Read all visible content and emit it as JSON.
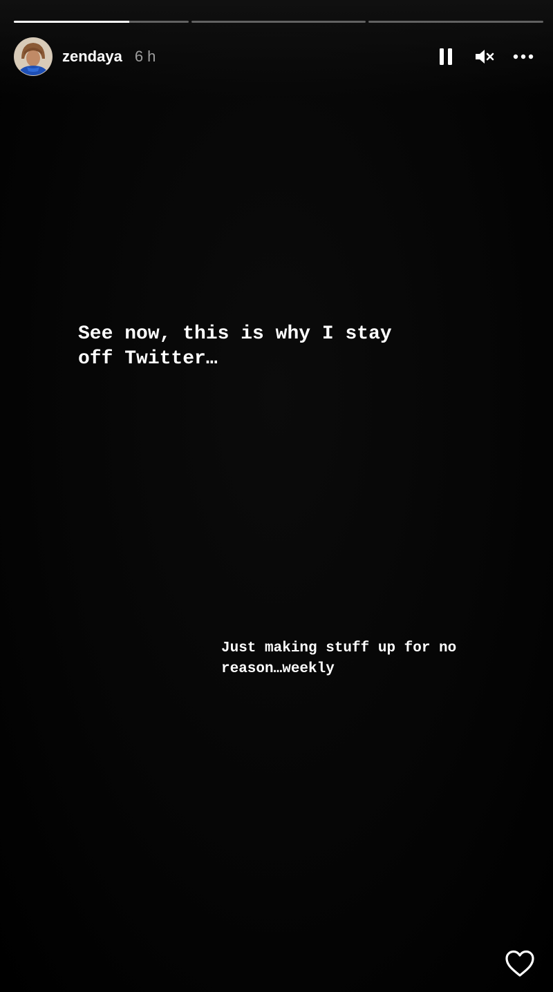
{
  "story": {
    "progress_segments": [
      {
        "fill": 0.66
      },
      {
        "fill": 0
      },
      {
        "fill": 0
      }
    ],
    "author": {
      "username": "zendaya",
      "timestamp": "6 h"
    },
    "controls": {
      "icons": [
        "pause-icon",
        "mute-icon",
        "more-options-icon"
      ]
    },
    "texts": {
      "primary": "See now, this is why I stay\noff Twitter…",
      "secondary": "Just making stuff up for no\nreason…weekly"
    },
    "reaction_icon": "heart-icon"
  }
}
